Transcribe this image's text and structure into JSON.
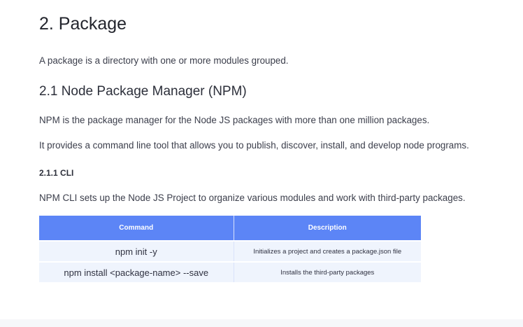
{
  "section": {
    "title": "2. Package",
    "intro": "A package is a directory with one or more modules grouped."
  },
  "subsection": {
    "title": "2.1 Node Package Manager (NPM)",
    "paragraphs": [
      "NPM is the package manager for the Node JS packages with more than one million packages.",
      "It provides a command line tool that allows you to publish, discover, install, and develop node programs."
    ]
  },
  "subsubsection": {
    "title": "2.1.1 CLI",
    "text": "NPM CLI sets up the Node JS Project to organize various modules and work with third-party packages."
  },
  "table": {
    "headers": [
      "Command",
      "Description"
    ],
    "rows": [
      [
        "npm init -y",
        "Initializes a project and creates a package.json file"
      ],
      [
        "npm install <package-name> --save",
        "Installs the third-party packages"
      ]
    ]
  },
  "colors": {
    "table_header": "#5c85f6",
    "table_row": "#eff4fd"
  }
}
